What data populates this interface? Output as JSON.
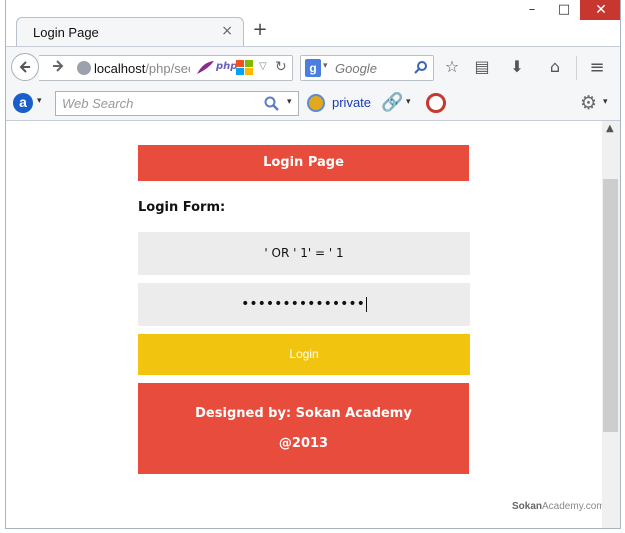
{
  "browser": {
    "tab_title": "Login Page",
    "tab_close": "×",
    "new_tab": "+",
    "window_controls": {
      "minimize": "–",
      "maximize": "□",
      "close": "✕"
    },
    "url_host": "localhost",
    "url_rest": "/php/sec",
    "search_engine_letter": "g",
    "search_placeholder": "Google",
    "icons": [
      "back-arrow-icon",
      "forward-arrow-icon",
      "globe-icon",
      "feather-icon",
      "php-icon",
      "windows-icon",
      "reload-icon",
      "star-icon",
      "reader-icon",
      "download-icon",
      "home-icon",
      "menu-icon"
    ]
  },
  "toolbar": {
    "ask_letter": "a",
    "web_search_placeholder": "Web Search",
    "private_label": "private",
    "icons": [
      "ask-icon",
      "magnifier-icon",
      "private-icon",
      "link-icon",
      "timer-icon",
      "settings-icon"
    ]
  },
  "page": {
    "header": "Login Page",
    "form_title": "Login Form:",
    "username_value": "' OR ' 1' = ' 1",
    "password_mask": "•••••••••••••••",
    "login_button": "Login",
    "footer_line1": "Designed by: Sokan Academy",
    "footer_line2": "@2013",
    "watermark_bold": "Sokan",
    "watermark_rest": "Academy.com"
  },
  "colors": {
    "header_red": "#e74c3c",
    "login_yellow": "#f1c40f",
    "field_gray": "#ececec",
    "close_red": "#c7372f"
  }
}
